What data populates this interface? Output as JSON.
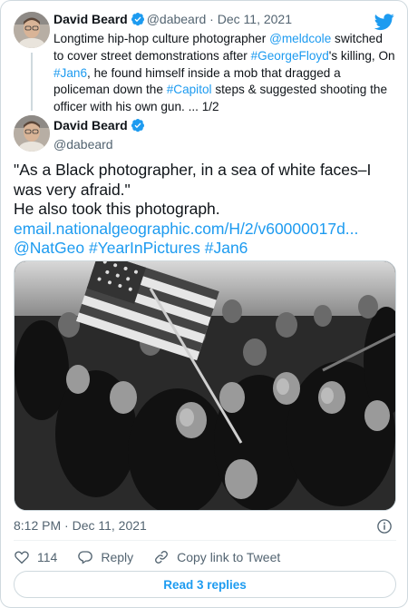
{
  "parent_tweet": {
    "author_name": "David Beard",
    "handle": "@dabeard",
    "date": "Dec 11, 2021",
    "text_segments": [
      {
        "text": "Longtime hip-hop culture photographer "
      },
      {
        "text": "@meldcole",
        "link": true
      },
      {
        "text": " switched to cover street demonstrations after "
      },
      {
        "text": "#GeorgeFloyd",
        "link": true
      },
      {
        "text": "'s killing, On "
      },
      {
        "text": "#Jan6",
        "link": true
      },
      {
        "text": ", he found himself inside a mob that dragged a policeman down the "
      },
      {
        "text": "#Capitol",
        "link": true
      },
      {
        "text": " steps & suggested shooting the officer with his own gun. ... 1/2"
      }
    ]
  },
  "main_tweet": {
    "author_name": "David Beard",
    "handle": "@dabeard",
    "line1": "\"As a Black photographer, in a sea of white faces–I",
    "line2": "was very afraid.\"",
    "line3": "He also took this photograph.",
    "link_url": "email.nationalgeographic.com/H/2/v60000017d...",
    "mention": "@NatGeo",
    "hashtag1": "#YearInPictures",
    "hashtag2": "#Jan6",
    "timestamp": "8:12 PM · Dec 11, 2021"
  },
  "actions": {
    "like_count": "114",
    "reply_label": "Reply",
    "copy_label": "Copy link to Tweet"
  },
  "read_replies_label": "Read 3 replies",
  "colors": {
    "accent": "#1d9bf0",
    "text": "#0f1419",
    "secondary": "#536471",
    "border": "#cfd9de",
    "like": "#f91880"
  },
  "icons": [
    "twitter-bird-icon",
    "verified-badge-icon",
    "heart-icon",
    "reply-icon",
    "link-icon",
    "info-icon"
  ]
}
